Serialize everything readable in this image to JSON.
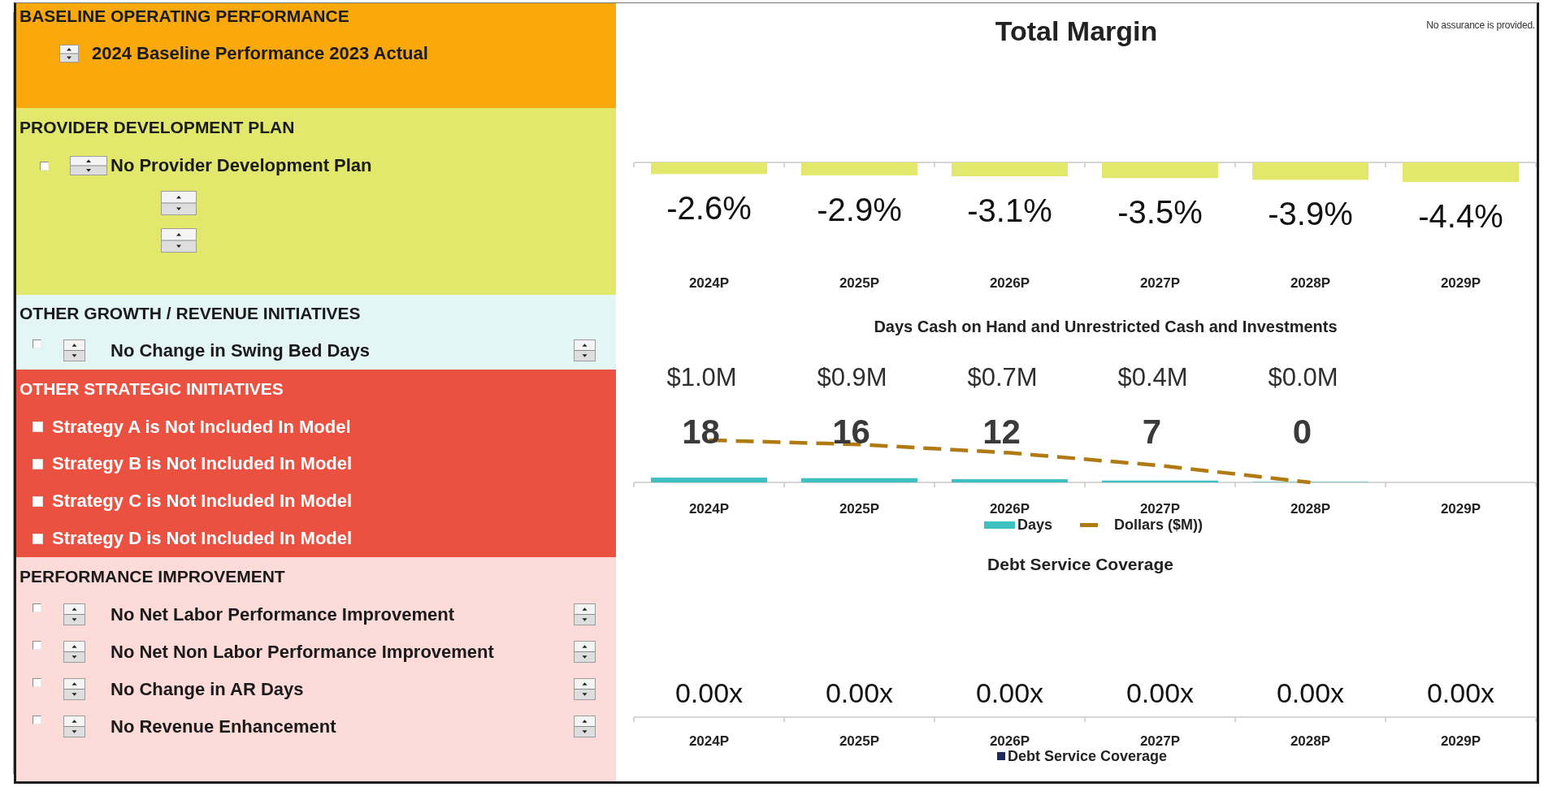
{
  "left_panel": {
    "sections": [
      {
        "title": "BASELINE OPERATING PERFORMANCE",
        "color": "#f9a90c",
        "items": [
          {
            "kind": "spin",
            "label": "2024 Baseline Performance 2023 Actual"
          }
        ]
      },
      {
        "title": "PROVIDER DEVELOPMENT PLAN",
        "color": "#e1e86b",
        "items": [
          {
            "kind": "check-spin",
            "checked": false,
            "label": "No Provider Development Plan"
          },
          {
            "kind": "spinner"
          },
          {
            "kind": "spinner"
          }
        ]
      },
      {
        "title": "OTHER GROWTH / REVENUE INITIATIVES",
        "color": "#e3f5f5",
        "items": [
          {
            "kind": "check-spin-spin",
            "checked": false,
            "label": "No Change in Swing Bed Days"
          }
        ]
      },
      {
        "title": "OTHER STRATEGIC INITIATIVES",
        "color": "#eb5141",
        "items": [
          {
            "kind": "check",
            "checked": false,
            "label": "Strategy A is Not Included In Model"
          },
          {
            "kind": "check",
            "checked": false,
            "label": "Strategy B is Not Included In Model"
          },
          {
            "kind": "check",
            "checked": false,
            "label": "Strategy C is Not Included In Model"
          },
          {
            "kind": "check",
            "checked": false,
            "label": "Strategy D is Not Included In Model"
          }
        ]
      },
      {
        "title": "PERFORMANCE IMPROVEMENT",
        "color": "#fcdbd9",
        "items": [
          {
            "kind": "check-spin-spin",
            "checked": false,
            "label": "No Net Labor Performance Improvement"
          },
          {
            "kind": "check-spin-spin",
            "checked": false,
            "label": "No Net Non Labor Performance Improvement"
          },
          {
            "kind": "check-spin-spin",
            "checked": false,
            "label": "No Change in AR Days"
          },
          {
            "kind": "check-spin-spin",
            "checked": false,
            "label": "No Revenue Enhancement"
          }
        ]
      }
    ]
  },
  "right_panel": {
    "note": "No assurance is provided.",
    "charts": [
      {
        "chart_data": {
          "type": "bar",
          "title": "Total Margin",
          "categories": [
            "2024P",
            "2025P",
            "2026P",
            "2027P",
            "2028P",
            "2029P"
          ],
          "series": [
            {
              "color": "#e2e86b",
              "values": [
                -2.6,
                -2.9,
                -3.1,
                -3.5,
                -3.9,
                -4.4
              ],
              "value_labels": [
                "-2.6%",
                "-2.9%",
                "-3.1%",
                "-3.5%",
                "-3.9%",
                "-4.4%"
              ]
            }
          ],
          "data_labels": true
        }
      },
      {
        "chart_data": {
          "type": "bar",
          "title": "Days Cash on Hand and Unrestricted Cash and Investments",
          "categories": [
            "2024P",
            "2025P",
            "2026P",
            "2027P",
            "2028P",
            "2029P"
          ],
          "series": [
            {
              "name": "Days",
              "type": "bar",
              "color": "#3fbfbf",
              "values": [
                18,
                16,
                12,
                7,
                0,
                null
              ],
              "value_labels": [
                "18",
                "16",
                "12",
                "7",
                "0",
                null
              ]
            },
            {
              "name": "Dollars ($M))",
              "type": "line",
              "axis": "y2",
              "line_style": "dashed",
              "color": "#b07a10",
              "values": [
                1.0,
                0.9,
                0.7,
                0.4,
                0.0,
                null
              ],
              "value_labels": [
                "$1.0M",
                "$0.9M",
                "$0.7M",
                "$0.4M",
                "$0.0M",
                null
              ]
            }
          ],
          "data_labels": true,
          "legend": "bottom"
        }
      },
      {
        "title": "Debt Service Coverage",
        "categories": [
          "2024P",
          "2025P",
          "2026P",
          "2027P",
          "2028P",
          "2029P"
        ],
        "value_labels": [
          "0.00x",
          "0.00x",
          "0.00x",
          "0.00x",
          "0.00x",
          "0.00x"
        ],
        "legend": {
          "label": "Debt Service Coverage",
          "color": "#1f2a5c"
        }
      }
    ]
  }
}
